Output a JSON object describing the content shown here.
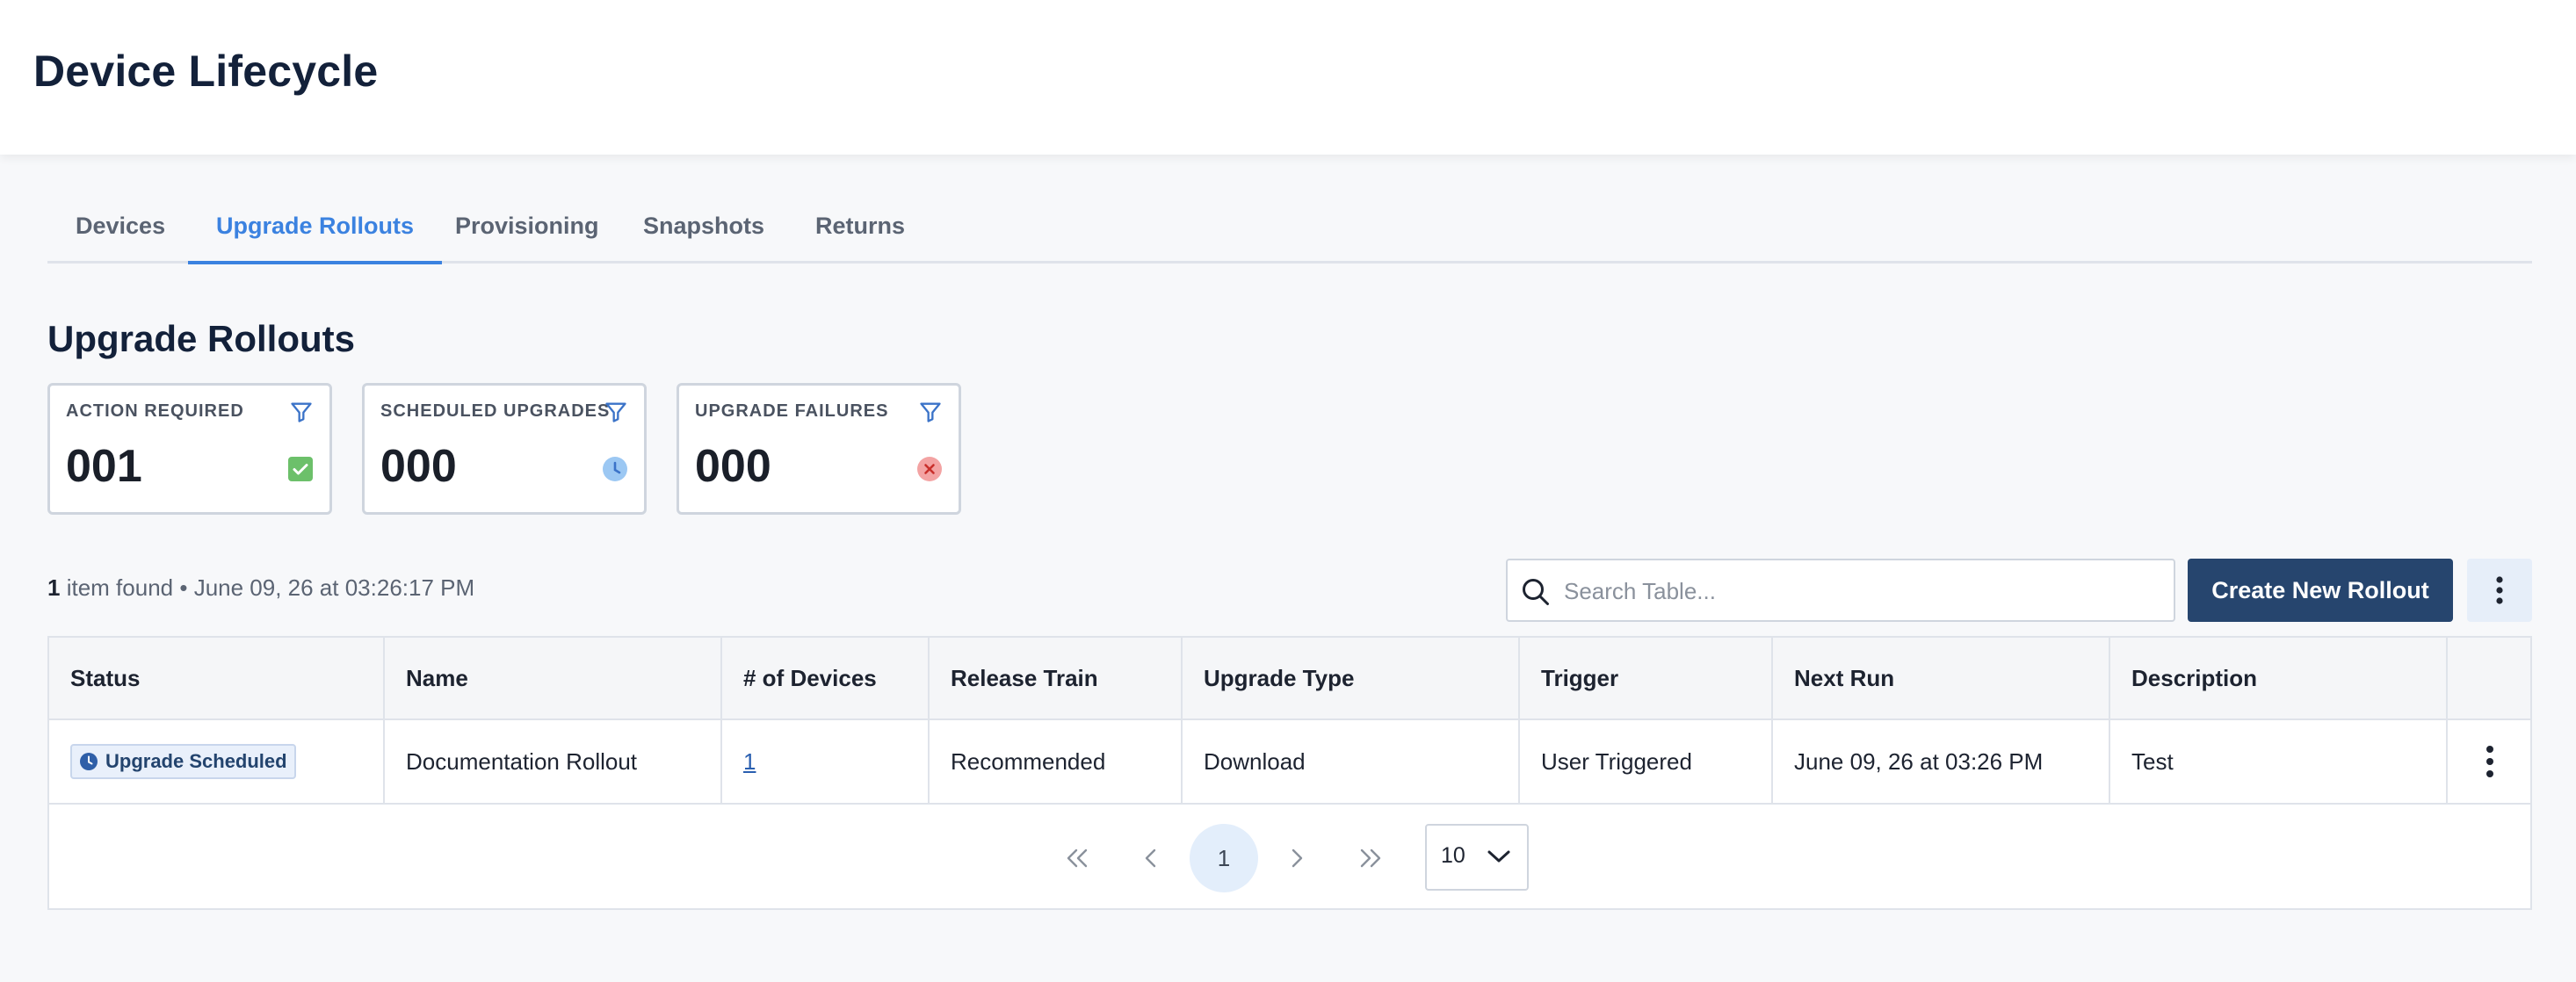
{
  "header": {
    "title": "Device Lifecycle"
  },
  "tabs": [
    {
      "label": "Devices",
      "active": false
    },
    {
      "label": "Upgrade Rollouts",
      "active": true
    },
    {
      "label": "Provisioning",
      "active": false
    },
    {
      "label": "Snapshots",
      "active": false
    },
    {
      "label": "Returns",
      "active": false
    }
  ],
  "section": {
    "title": "Upgrade Rollouts"
  },
  "cards": [
    {
      "label": "ACTION REQUIRED",
      "value": "001",
      "icon": "check-icon",
      "color": "#6cc06a"
    },
    {
      "label": "SCHEDULED UPGRADES",
      "value": "000",
      "icon": "clock-icon",
      "color": "#8fbff0"
    },
    {
      "label": "UPGRADE FAILURES",
      "value": "000",
      "icon": "x-circle-icon",
      "color": "#f19a9a"
    }
  ],
  "toolbar": {
    "count": "1",
    "count_suffix": "item found",
    "separator": "•",
    "timestamp": "June 09, 26 at 03:26:17 PM",
    "search_placeholder": "Search Table...",
    "create_label": "Create New Rollout"
  },
  "table": {
    "columns": [
      "Status",
      "Name",
      "# of Devices",
      "Release Train",
      "Upgrade Type",
      "Trigger",
      "Next Run",
      "Description"
    ],
    "rows": [
      {
        "status": "Upgrade Scheduled",
        "name": "Documentation Rollout",
        "devices": "1",
        "release_train": "Recommended",
        "upgrade_type": "Download",
        "trigger": "User Triggered",
        "next_run": "June 09, 26 at 03:26 PM",
        "description": "Test"
      }
    ]
  },
  "pagination": {
    "current_page": "1",
    "page_size": "10"
  },
  "colors": {
    "accent": "#3b82e0",
    "primary_button": "#26456e",
    "title": "#13213a"
  }
}
